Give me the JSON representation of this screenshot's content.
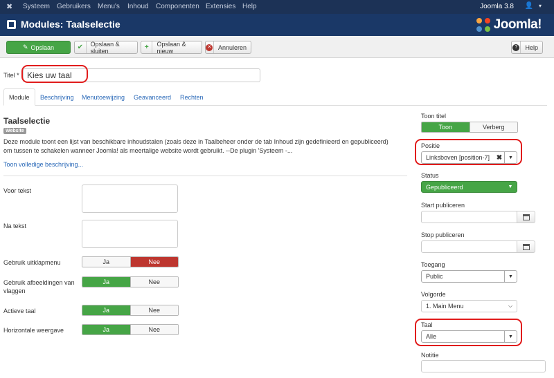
{
  "topnav": {
    "menu": [
      "Systeem",
      "Gebruikers",
      "Menu's",
      "Inhoud",
      "Componenten",
      "Extensies",
      "Help"
    ],
    "version": "Joomla 3.8",
    "user_icon": "user-icon"
  },
  "header": {
    "title": "Modules: Taalselectie",
    "logo_text": "Joomla!"
  },
  "toolbar": {
    "save": "Opslaan",
    "save_close": "Opslaan & sluiten",
    "save_new": "Opslaan & nieuw",
    "cancel": "Annuleren",
    "help": "Help"
  },
  "title_field": {
    "label": "Titel *",
    "value": "Kies uw taal"
  },
  "tabs": [
    "Module",
    "Beschrijving",
    "Menutoewijzing",
    "Geavanceerd",
    "Rechten"
  ],
  "module": {
    "name": "Taalselectie",
    "badge": "Website",
    "description": "Deze module toont een lijst van beschikbare inhoudstalen (zoals deze in Taalbeheer onder de tab Inhoud zijn gedefinieerd en gepubliceerd) om tussen te schakelen wanneer Joomla! als meertalige website wordt gebruikt. --De plugin 'Systeem -...",
    "more_link": "Toon volledige beschrijving..."
  },
  "fields": {
    "voor_tekst": "Voor tekst",
    "na_tekst": "Na tekst",
    "dropdown": {
      "label": "Gebruik uitklapmenu",
      "yes": "Ja",
      "no": "Nee",
      "value": "Nee"
    },
    "flags": {
      "label": "Gebruik afbeeldingen van vlaggen",
      "yes": "Ja",
      "no": "Nee",
      "value": "Ja"
    },
    "active": {
      "label": "Actieve taal",
      "yes": "Ja",
      "no": "Nee",
      "value": "Ja"
    },
    "horizontal": {
      "label": "Horizontale weergave",
      "yes": "Ja",
      "no": "Nee",
      "value": "Ja"
    }
  },
  "sidebar": {
    "show_title": {
      "label": "Toon titel",
      "show": "Toon",
      "hide": "Verberg",
      "value": "Toon"
    },
    "position": {
      "label": "Positie",
      "value": "Linksboven [position-7]"
    },
    "status": {
      "label": "Status",
      "value": "Gepubliceerd"
    },
    "start": {
      "label": "Start publiceren"
    },
    "stop": {
      "label": "Stop publiceren"
    },
    "access": {
      "label": "Toegang",
      "value": "Public"
    },
    "order": {
      "label": "Volgorde",
      "value": "1. Main Menu"
    },
    "language": {
      "label": "Taal",
      "value": "Alle"
    },
    "note": {
      "label": "Notitie"
    }
  },
  "colors": {
    "nav": "#1c3256",
    "header": "#1a3867",
    "green": "#46a546",
    "red": "#bd362f",
    "link": "#2a69b8",
    "highlight": "#e11c1c"
  }
}
